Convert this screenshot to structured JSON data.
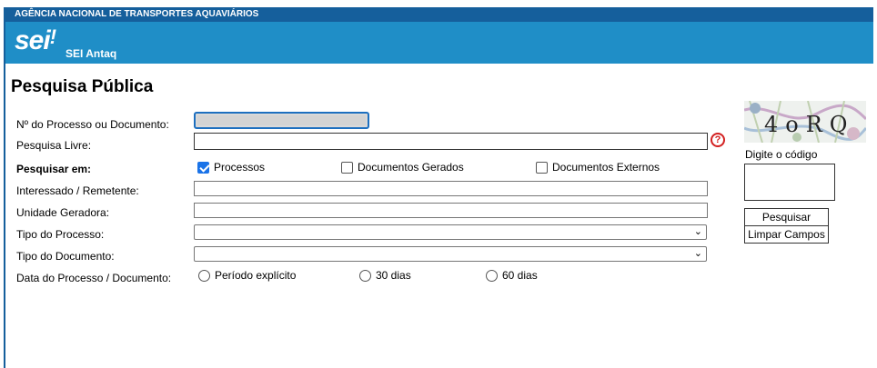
{
  "header": {
    "agency": "AGÊNCIA NACIONAL DE TRANSPORTES AQUAVIÁRIOS",
    "logo_text": "sei",
    "logo_mark": "!",
    "system_name": "SEI Antaq"
  },
  "page": {
    "title": "Pesquisa Pública"
  },
  "form": {
    "processo_label": "Nº do Processo ou Documento:",
    "processo_value": "",
    "pesquisa_livre_label": "Pesquisa Livre:",
    "pesquisa_livre_value": "",
    "help_glyph": "?",
    "pesquisar_em_label": "Pesquisar em:",
    "pesquisar_em_options": [
      {
        "label": "Processos",
        "checked": true
      },
      {
        "label": "Documentos Gerados",
        "checked": false
      },
      {
        "label": "Documentos Externos",
        "checked": false
      }
    ],
    "interessado_label": "Interessado / Remetente:",
    "unidade_label": "Unidade Geradora:",
    "tipo_processo_label": "Tipo do Processo:",
    "tipo_processo_value": "",
    "tipo_documento_label": "Tipo do Documento:",
    "tipo_documento_value": "",
    "data_label": "Data do Processo / Documento:",
    "data_options": [
      {
        "label": "Período explícito",
        "selected": false
      },
      {
        "label": "30 dias",
        "selected": false
      },
      {
        "label": "60 dias",
        "selected": false
      }
    ]
  },
  "captcha": {
    "code_image_text": "4oRQ",
    "label": "Digite o código",
    "value": ""
  },
  "buttons": {
    "search": "Pesquisar",
    "clear": "Limpar Campos"
  },
  "colors": {
    "top_bar": "#155f9c",
    "brand_bar": "#1f8ec7",
    "help_icon": "#d32020",
    "checkbox_checked": "#1a73e8"
  }
}
